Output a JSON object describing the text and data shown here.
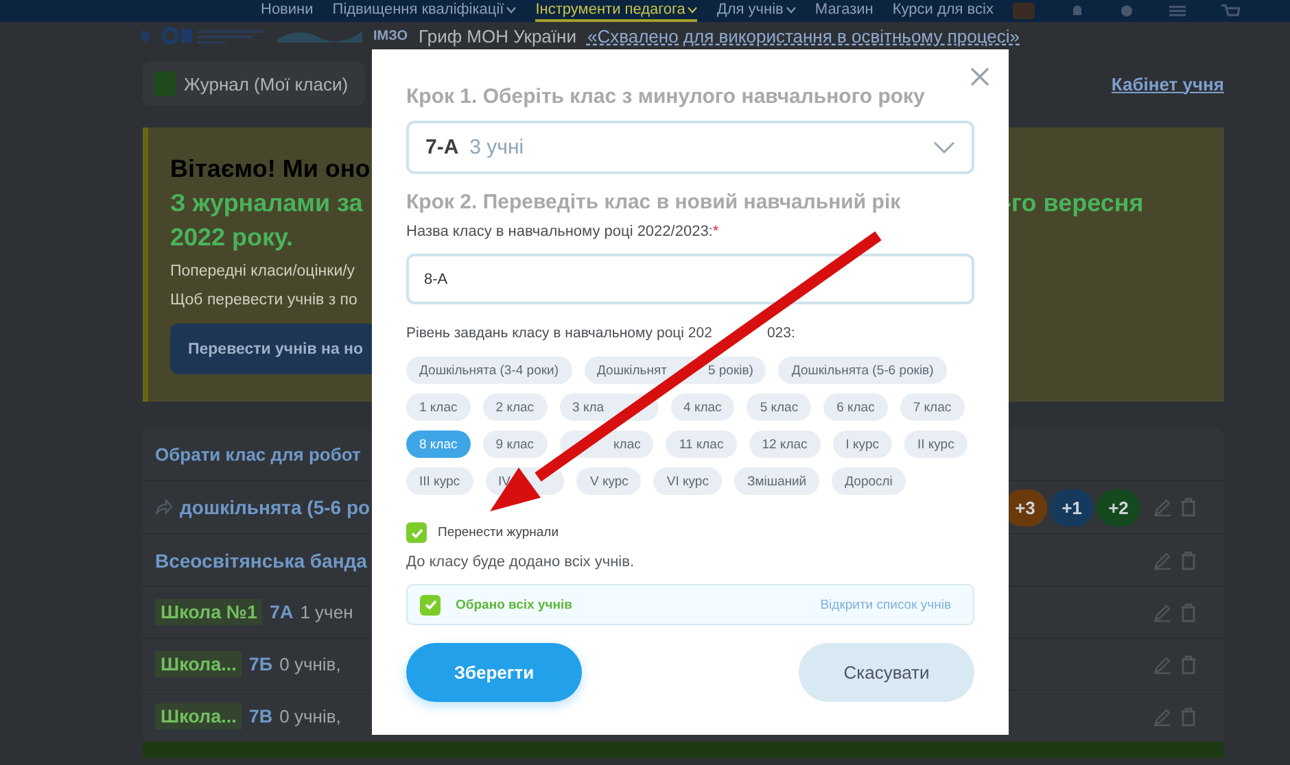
{
  "top_nav": {
    "items": [
      {
        "label": "Новини",
        "dropdown": false,
        "selected": false
      },
      {
        "label": "Підвищення кваліфікації",
        "dropdown": true,
        "selected": false
      },
      {
        "label": "Інструменти педагога",
        "dropdown": true,
        "selected": true
      },
      {
        "label": "Для учнів",
        "dropdown": true,
        "selected": false
      },
      {
        "label": "Магазин",
        "dropdown": false,
        "selected": false
      },
      {
        "label": "Курси для всіх",
        "dropdown": false,
        "selected": false
      }
    ]
  },
  "grif_bar": {
    "logo_text": "ІМЗО",
    "text": "Гриф МОН України",
    "link": "«Схвалено для використання в освітньому процесі»"
  },
  "journal_button": "Журнал (Мої класи)",
  "cabinet_link": "Кабінет учня",
  "banner": {
    "title": "Вітаємо! Ми оно",
    "subtitle_left": "З журналами за",
    "subtitle_right": "-го вересня",
    "subtitle_line2": "2022 року.",
    "lines": [
      "Попередні класи/оцінки/у",
      "Щоб перевести учнів з по"
    ],
    "button": "Перевести учнів на но"
  },
  "class_list": {
    "title": "Обрати клас для робот",
    "rows": [
      {
        "kind": "group",
        "name": "дошкільнята (5-6 ро",
        "counters": [
          {
            "text": "+3",
            "color": "#6b3a0c"
          },
          {
            "text": "+1",
            "color": "#153a5e"
          },
          {
            "text": "+2",
            "color": "#15491f"
          }
        ]
      },
      {
        "kind": "org",
        "name": "Всеосвітянська банда"
      },
      {
        "kind": "class",
        "school": "Школа №1",
        "class_name": "7А",
        "info": "1 учен"
      },
      {
        "kind": "class",
        "school": "Школа...",
        "class_name": "7Б",
        "info": "0 учнів,"
      },
      {
        "kind": "class",
        "school": "Школа...",
        "class_name": "7В",
        "info": "0 учнів,"
      }
    ]
  },
  "modal": {
    "step1": "Крок 1. Оберіть клас з минулого навчального року",
    "select": {
      "value": "7-А",
      "hint": "3 учні"
    },
    "step2": "Крок 2. Переведіть клас в новий навчальний рік",
    "name_label": "Назва класу в навчальному році 2022/2023:",
    "required_mark": "*",
    "name_value": "8-А",
    "level_label": [
      "Рівень завдань класу в навчальному році 202",
      "023:"
    ],
    "levels": [
      {
        "kind": "plain",
        "label": "Дошкільнята (3-4 роки)",
        "selected": false
      },
      {
        "kind": "split",
        "label": "Дошкільнят",
        "label_end": "5 років)",
        "selected": false
      },
      {
        "kind": "plain",
        "label": "Дошкільнята (5-6 років)",
        "selected": false
      },
      {
        "kind": "plain",
        "label": "1 клас",
        "selected": false
      },
      {
        "kind": "plain",
        "label": "2 клас",
        "selected": false
      },
      {
        "kind": "cut_end",
        "label": "3 кла",
        "selected": false
      },
      {
        "kind": "plain",
        "label": "4 клас",
        "selected": false
      },
      {
        "kind": "plain",
        "label": "5 клас",
        "selected": false
      },
      {
        "kind": "plain",
        "label": "6 клас",
        "selected": false
      },
      {
        "kind": "plain",
        "label": "7 клас",
        "selected": false
      },
      {
        "kind": "plain",
        "label": "8 клас",
        "selected": true
      },
      {
        "kind": "plain",
        "label": "9 клас",
        "selected": false
      },
      {
        "kind": "cut_start",
        "label": "клас",
        "selected": false
      },
      {
        "kind": "plain",
        "label": "11 клас",
        "selected": false
      },
      {
        "kind": "plain",
        "label": "12 клас",
        "selected": false
      },
      {
        "kind": "plain",
        "label": "I курс",
        "selected": false
      },
      {
        "kind": "plain",
        "label": "II курс",
        "selected": false
      },
      {
        "kind": "plain",
        "label": "III курс",
        "selected": false
      },
      {
        "kind": "cut_end",
        "label": "IV",
        "selected": false
      },
      {
        "kind": "plain",
        "label": "V курс",
        "selected": false
      },
      {
        "kind": "plain",
        "label": "VI курс",
        "selected": false
      },
      {
        "kind": "plain",
        "label": "Змішаний",
        "selected": false
      },
      {
        "kind": "plain",
        "label": "Дорослі",
        "selected": false
      }
    ],
    "transfer": {
      "label": "Перенести журнали",
      "checked": true
    },
    "note": "До класу буде додано всіх учнів.",
    "students": {
      "label": "Обрано всіх учнів",
      "checked": true,
      "link": "Відкрити список учнів"
    },
    "save": "Зберегти",
    "cancel": "Скасувати"
  }
}
